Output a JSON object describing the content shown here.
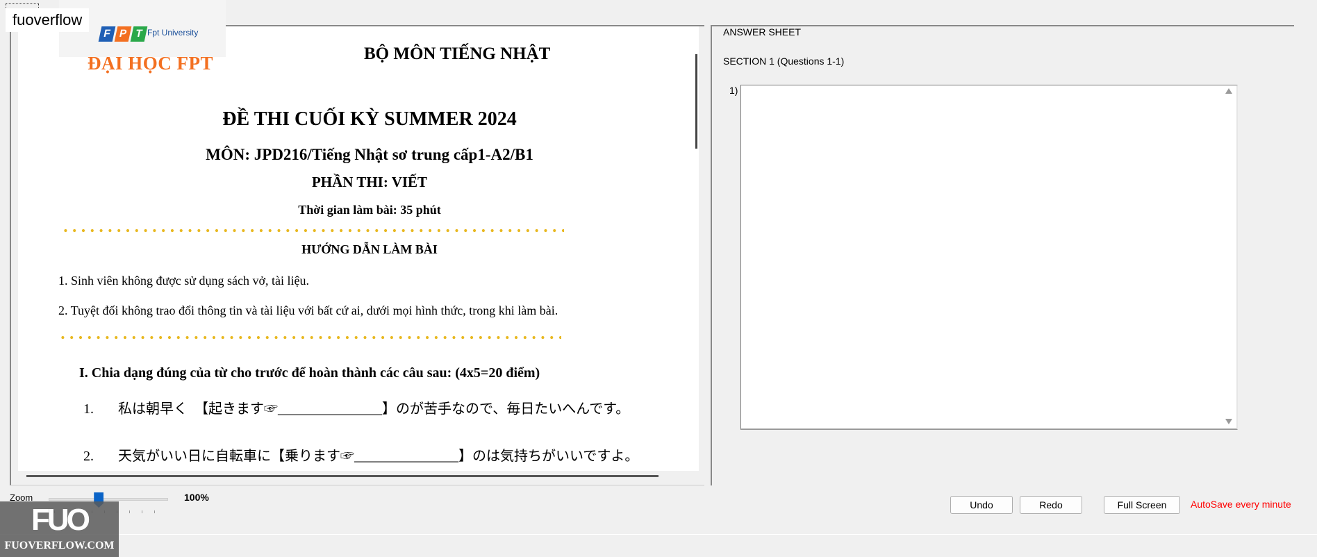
{
  "corner_label": "fuoverflow",
  "question": {
    "logo": {
      "letters": [
        "F",
        "P",
        "T"
      ],
      "colors": [
        "#1f5fb5",
        "#f37021",
        "#2aa84a"
      ],
      "small_text": "Fpt University",
      "brand_text": "ĐẠI HỌC FPT"
    },
    "department": "BỘ MÔN TIẾNG NHẬT",
    "title": "ĐỀ THI CUỐI KỲ SUMMER 2024",
    "subject": "MÔN: JPD216/Tiếng Nhật sơ trung cấp1-A2/B1",
    "part": "PHẦN THI:  VIẾT",
    "duration": "Thời gian làm bài: 35 phút",
    "guide_title": "HƯỚNG DẪN LÀM BÀI",
    "rules": [
      "1. Sinh viên không được sử dụng sách vở, tài liệu.",
      "2. Tuyệt đối không trao đổi thông tin và tài liệu với bất cứ ai, dưới mọi hình thức, trong khi làm bài."
    ],
    "section_i": "I.   Chia dạng đúng của từ cho trước để hoàn thành các câu sau:   (4x5=20 điểm)",
    "questions": [
      {
        "num": "1.",
        "text": "私は朝早く　【起きます☞_______________】のが苦手なので、毎日たいへんです。"
      },
      {
        "num": "2.",
        "text": "天気がいい日に自転車に【乗ります☞_______________】のは気持ちがいいですよ。"
      }
    ]
  },
  "answer": {
    "title": "ANSWER SHEET",
    "section": "SECTION 1 (Questions 1-1)",
    "item_label": "1)",
    "value": ""
  },
  "toolbar": {
    "zoom_label": "Zoom",
    "zoom_value": "100%",
    "zoom_fraction": 0.42,
    "undo": "Undo",
    "redo": "Redo",
    "full_screen": "Full Screen",
    "autosave": "AutoSave every minute"
  },
  "watermark": {
    "logo": "FUO",
    "text": "FUOVERFLOW.COM"
  }
}
